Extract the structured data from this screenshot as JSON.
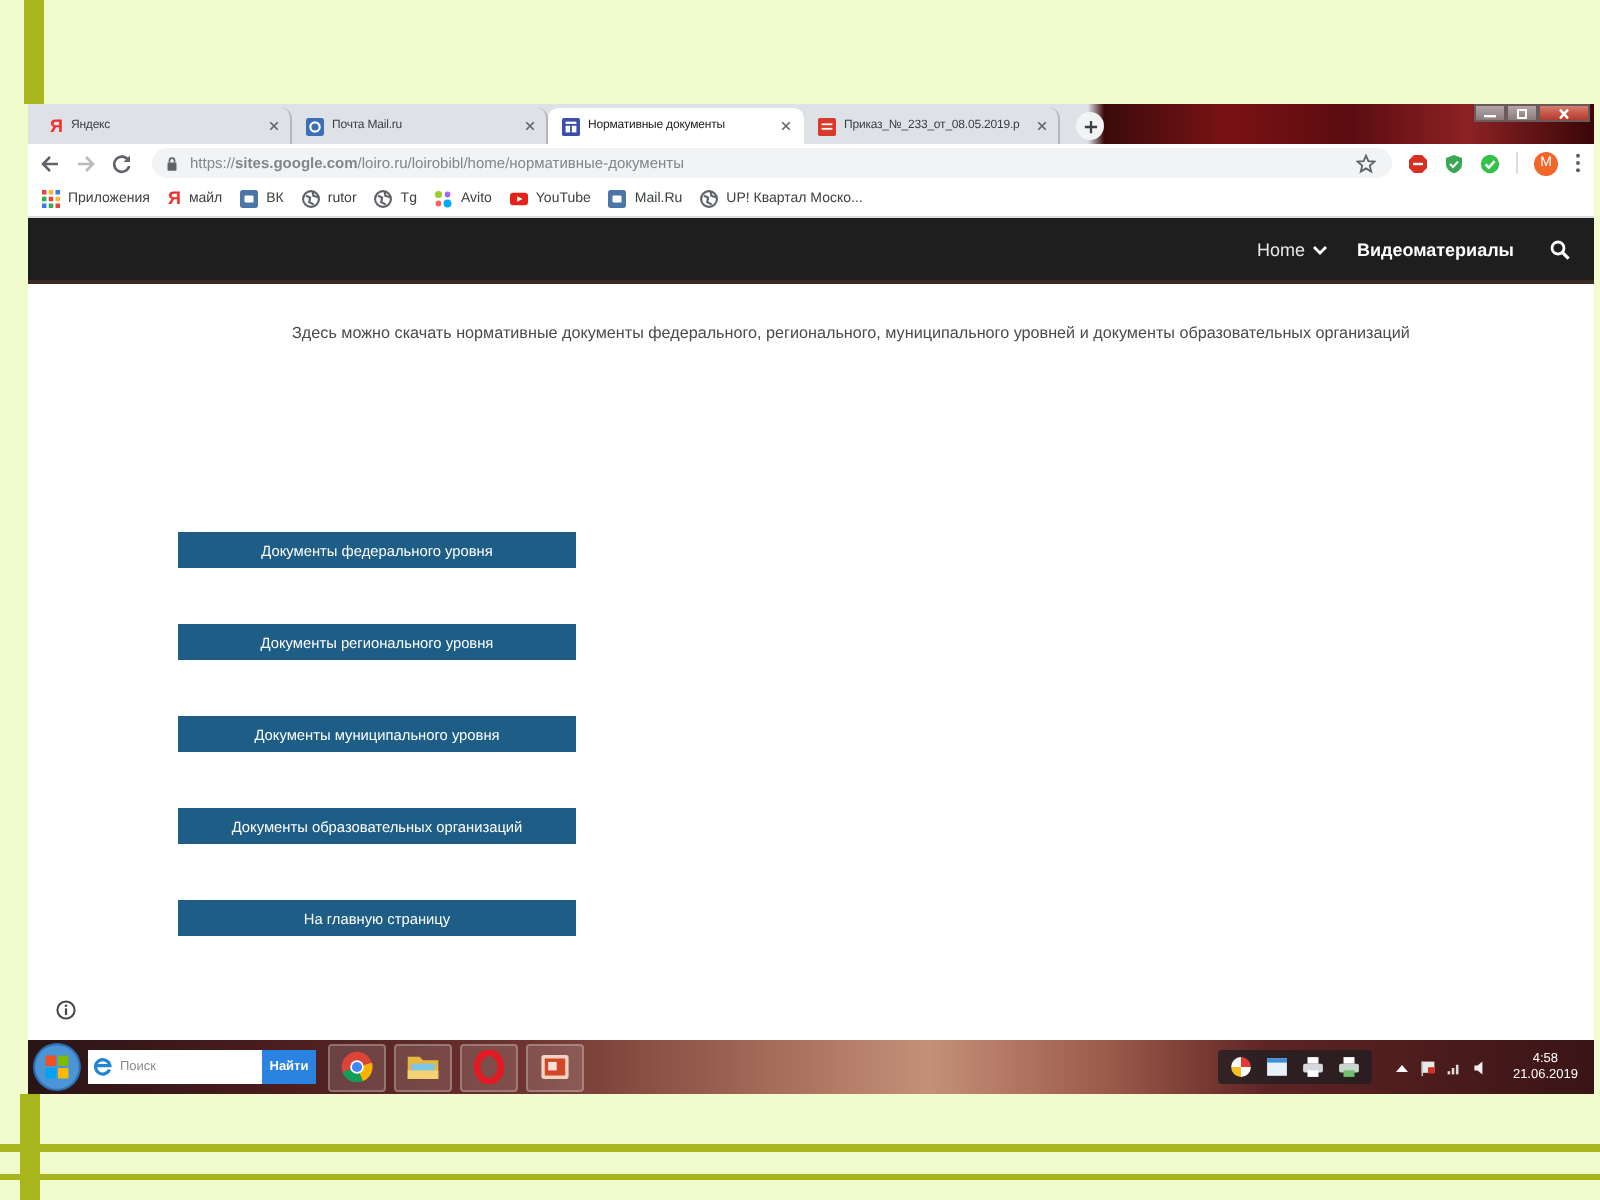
{
  "browser": {
    "tabs": [
      {
        "title": "Яндекс",
        "kind": "letter",
        "glyph": "Я",
        "selected": false
      },
      {
        "title": "Почта Mail.ru",
        "kind": "mail",
        "selected": false
      },
      {
        "title": "Нормативные документы",
        "kind": "sites",
        "selected": true
      },
      {
        "title": "Приказ_№_233_от_08.05.2019.р",
        "kind": "pdf",
        "selected": false
      }
    ],
    "url": "https://**sites.google.com**/loiro.ru/loirobibl/home/нормативные-документы",
    "profile_initial": "М",
    "bookmarks": [
      {
        "label": "Приложения",
        "kind": "apps"
      },
      {
        "label": "майл",
        "kind": "letter",
        "glyph": "Я"
      },
      {
        "label": "ВК",
        "kind": "square"
      },
      {
        "label": "rutor",
        "kind": "globe"
      },
      {
        "label": "Tg",
        "kind": "globe"
      },
      {
        "label": "Avito",
        "kind": "dots"
      },
      {
        "label": "YouTube",
        "kind": "play"
      },
      {
        "label": "Mail.Ru",
        "kind": "square"
      },
      {
        "label": "UP! Квартал Моско...",
        "kind": "globe"
      }
    ]
  },
  "site": {
    "nav": [
      {
        "label": "Home",
        "kind": "dropdown"
      },
      {
        "label": "Видеоматериалы",
        "kind": "link"
      }
    ],
    "intro": "Здесь можно скачать нормативные документы федерального, регионального, муниципального уровней и документы образовательных организаций",
    "buttons": [
      "Документы федерального уровня",
      "Документы регионального уровня",
      "Документы муниципального уровня",
      "Документы образовательных организаций",
      "На главную страницу"
    ]
  },
  "taskbar": {
    "search": {
      "placeholder": "Поиск",
      "button": "Найти"
    },
    "apps": [
      {
        "kind": "chrome"
      },
      {
        "kind": "folder"
      },
      {
        "kind": "opera"
      },
      {
        "kind": "slides"
      }
    ],
    "clock": {
      "time": "4:58",
      "date": "21.06.2019"
    }
  }
}
